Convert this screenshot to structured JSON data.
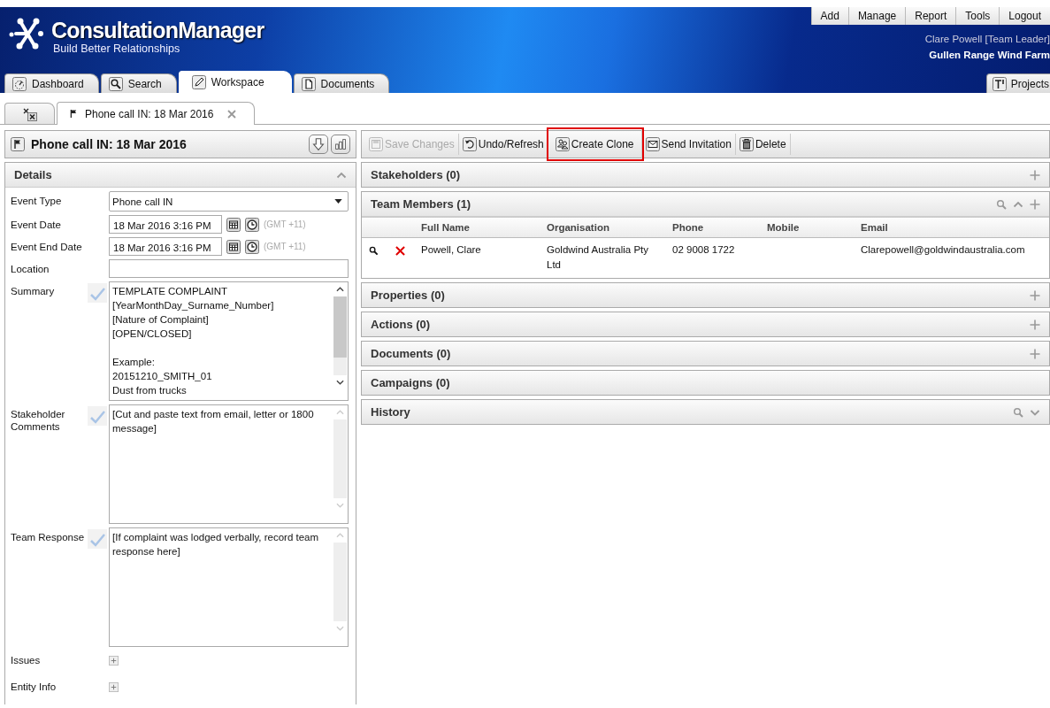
{
  "app": {
    "title": "ConsultationManager",
    "tagline": "Build Better Relationships"
  },
  "top_menu": [
    "Add",
    "Manage",
    "Report",
    "Tools",
    "Logout"
  ],
  "user": {
    "name": "Clare Powell [Team Leader]",
    "project": "Gullen Range Wind Farm"
  },
  "main_tabs": [
    {
      "label": "Dashboard",
      "selected": false
    },
    {
      "label": "Search",
      "selected": false
    },
    {
      "label": "Workspace",
      "selected": true
    },
    {
      "label": "Documents",
      "selected": false
    }
  ],
  "projects_button": {
    "label": "Projects"
  },
  "doc_tabs": [
    {
      "kind": "close-all",
      "selected": false
    },
    {
      "kind": "record",
      "label": "Phone call IN: 18 Mar 2016",
      "selected": true
    }
  ],
  "record": {
    "title": "Phone call IN: 18 Mar 2016"
  },
  "details": {
    "title": "Details",
    "expanded": true,
    "fields": [
      {
        "kind": "select",
        "label": "Event Type",
        "value": "Phone call IN"
      },
      {
        "kind": "datetime",
        "label": "Event Date",
        "value": "18 Mar 2016 3:16 PM",
        "timezone": "(GMT +11)"
      },
      {
        "kind": "datetime",
        "label": "Event End Date",
        "value": "18 Mar 2016 3:16 PM",
        "timezone": "(GMT +11)"
      },
      {
        "kind": "text",
        "label": "Location"
      },
      {
        "kind": "textarea",
        "label": "Summary",
        "value": "TEMPLATE COMPLAINT\n[YearMonthDay_Surname_Number]\n[Nature of Complaint]\n[OPEN/CLOSED]\n\nExample:\n20151210_SMITH_01\nDust from trucks",
        "scrollable": true
      },
      {
        "kind": "textarea",
        "label": "Stakeholder Comments",
        "value": "[Cut and paste text from email, letter or 1800 message]",
        "scrollable": false
      },
      {
        "kind": "textarea",
        "label": "Team Response",
        "value": "[If complaint was lodged verbally, record team response here]",
        "scrollable": false
      },
      {
        "kind": "expander",
        "label": "Issues"
      },
      {
        "kind": "expander",
        "label": "Entity Info"
      }
    ]
  },
  "toolbar": [
    {
      "label": "Save Changes",
      "disabled": true,
      "highlighted": false
    },
    {
      "label": "Undo/Refresh",
      "disabled": false,
      "highlighted": false
    },
    {
      "label": "Create Clone",
      "disabled": false,
      "highlighted": true
    },
    {
      "label": "Send Invitation",
      "disabled": false,
      "highlighted": false
    },
    {
      "label": "Delete",
      "disabled": false,
      "highlighted": false
    }
  ],
  "sections": [
    {
      "title": "Stakeholders (0)",
      "expanded": false,
      "can_add": true
    },
    {
      "title": "Team Members (1)",
      "expanded": true,
      "searchable": true,
      "toggle": true,
      "can_add": true,
      "table": {
        "columns": [
          "Full Name",
          "Organisation",
          "Phone",
          "Mobile",
          "Email"
        ],
        "rows": [
          {
            "cells": [
              "Powell, Clare",
              "Goldwind Australia Pty Ltd",
              "02 9008 1722",
              null,
              "Clarepowell@goldwindaustralia.com"
            ]
          }
        ]
      }
    },
    {
      "title": "Properties (0)",
      "expanded": false,
      "can_add": true
    },
    {
      "title": "Actions (0)",
      "expanded": false,
      "can_add": true
    },
    {
      "title": "Documents (0)",
      "expanded": false,
      "can_add": true
    },
    {
      "title": "Campaigns (0)",
      "expanded": false
    },
    {
      "title": "History",
      "expanded": false,
      "searchable": true,
      "toggle": true
    }
  ]
}
